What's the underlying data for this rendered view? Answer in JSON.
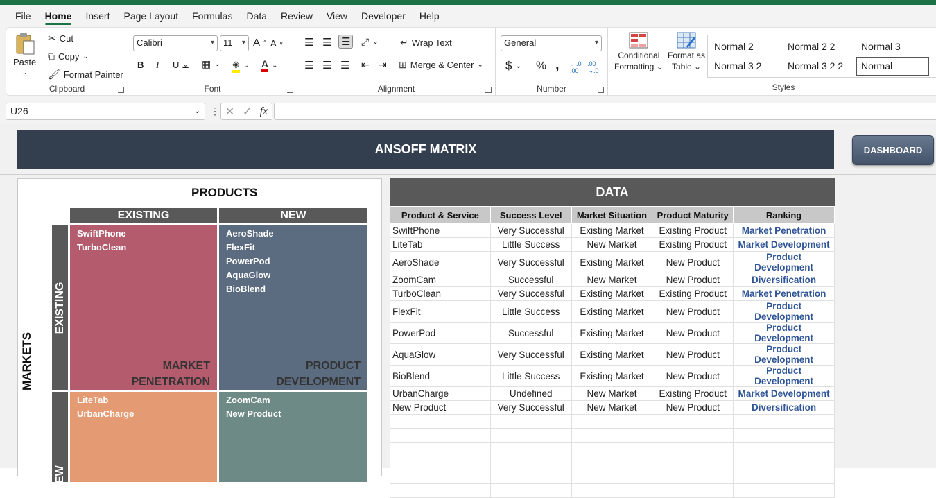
{
  "menu": [
    "File",
    "Home",
    "Insert",
    "Page Layout",
    "Formulas",
    "Data",
    "Review",
    "View",
    "Developer",
    "Help"
  ],
  "ribbon": {
    "clipboard": {
      "paste": "Paste",
      "cut": "Cut",
      "copy": "Copy",
      "format_painter": "Format Painter",
      "label": "Clipboard"
    },
    "font": {
      "name": "Calibri",
      "size": "11",
      "label": "Font"
    },
    "alignment": {
      "wrap_text": "Wrap Text",
      "merge_center": "Merge & Center",
      "label": "Alignment"
    },
    "number": {
      "format": "General",
      "label": "Number"
    },
    "conditional_formatting": [
      "Conditional",
      "Formatting"
    ],
    "format_as_table": [
      "Format as",
      "Table"
    ],
    "styles": {
      "items": [
        "Normal 2",
        "Normal 2 2",
        "Normal 3",
        "Normal 3 2",
        "Normal 3 2 2",
        "Normal"
      ],
      "label": "Styles"
    }
  },
  "formula_bar": {
    "name_box": "U26",
    "value": ""
  },
  "sheet": {
    "banner": "ANSOFF MATRIX",
    "dashboard_button": "DASHBOARD",
    "matrix": {
      "title": "PRODUCTS",
      "markets_label": "MARKETS",
      "col_existing": "EXISTING",
      "col_new": "NEW",
      "row_existing": "EXISTING",
      "row_new": "NEW",
      "quadrants": {
        "market_penetration": {
          "items": [
            "SwiftPhone",
            "TurboClean"
          ],
          "label": [
            "MARKET",
            "PENETRATION"
          ],
          "color": "#b45c6e"
        },
        "product_development": {
          "items": [
            "AeroShade",
            "FlexFit",
            "PowerPod",
            "AquaGlow",
            "BioBlend"
          ],
          "label": [
            "PRODUCT",
            "DEVELOPMENT"
          ],
          "color": "#5b6b80"
        },
        "market_development": {
          "items": [
            "LiteTab",
            "UrbanCharge"
          ],
          "color": "#e49a72"
        },
        "diversification": {
          "items": [
            "ZoomCam",
            "New Product"
          ],
          "color": "#6e8a86"
        }
      }
    },
    "data": {
      "title": "DATA",
      "headers": [
        "Product & Service",
        "Success Level",
        "Market Situation",
        "Product Maturity",
        "Ranking"
      ],
      "rows": [
        [
          "SwiftPhone",
          "Very Successful",
          "Existing Market",
          "Existing Product",
          "Market Penetration"
        ],
        [
          "LiteTab",
          "Little Success",
          "New Market",
          "Existing Product",
          "Market Development"
        ],
        [
          "AeroShade",
          "Very Successful",
          "Existing Market",
          "New Product",
          "Product Development"
        ],
        [
          "ZoomCam",
          "Successful",
          "New Market",
          "New Product",
          "Diversification"
        ],
        [
          "TurboClean",
          "Very Successful",
          "Existing Market",
          "Existing Product",
          "Market Penetration"
        ],
        [
          "FlexFit",
          "Little Success",
          "Existing Market",
          "New Product",
          "Product Development"
        ],
        [
          "PowerPod",
          "Successful",
          "Existing Market",
          "New Product",
          "Product Development"
        ],
        [
          "AquaGlow",
          "Very Successful",
          "Existing Market",
          "New Product",
          "Product Development"
        ],
        [
          "BioBlend",
          "Little Success",
          "Existing Market",
          "New Product",
          "Product Development"
        ],
        [
          "UrbanCharge",
          "Undefined",
          "New Market",
          "Existing Product",
          "Market Development"
        ],
        [
          "New Product",
          "Very Successful",
          "New Market",
          "New Product",
          "Diversification"
        ]
      ]
    }
  }
}
